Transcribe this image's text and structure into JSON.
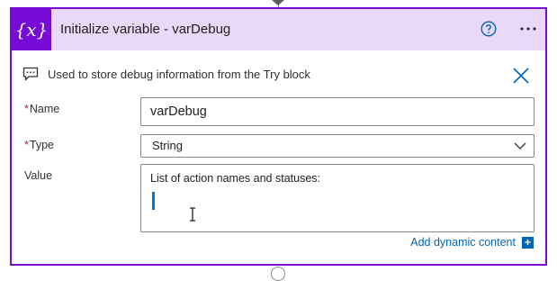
{
  "action": {
    "title": "Initialize variable - varDebug",
    "icon_text": "{x}",
    "description": "Used to store debug information from the Try block",
    "accent_color": "#770bd6",
    "header_bg": "#ead8f8"
  },
  "fields": {
    "name": {
      "label": "Name",
      "required_mark": "*",
      "value": "varDebug"
    },
    "type": {
      "label": "Type",
      "required_mark": "*",
      "selected": "String"
    },
    "value": {
      "label": "Value",
      "text": "List of action names and statuses:"
    }
  },
  "dynamic_content": {
    "label": "Add dynamic content",
    "plus": "+"
  },
  "icons": [
    "variable-icon",
    "help-icon",
    "more-icon",
    "comment-icon",
    "close-icon",
    "chevron-down-icon",
    "add-icon"
  ]
}
